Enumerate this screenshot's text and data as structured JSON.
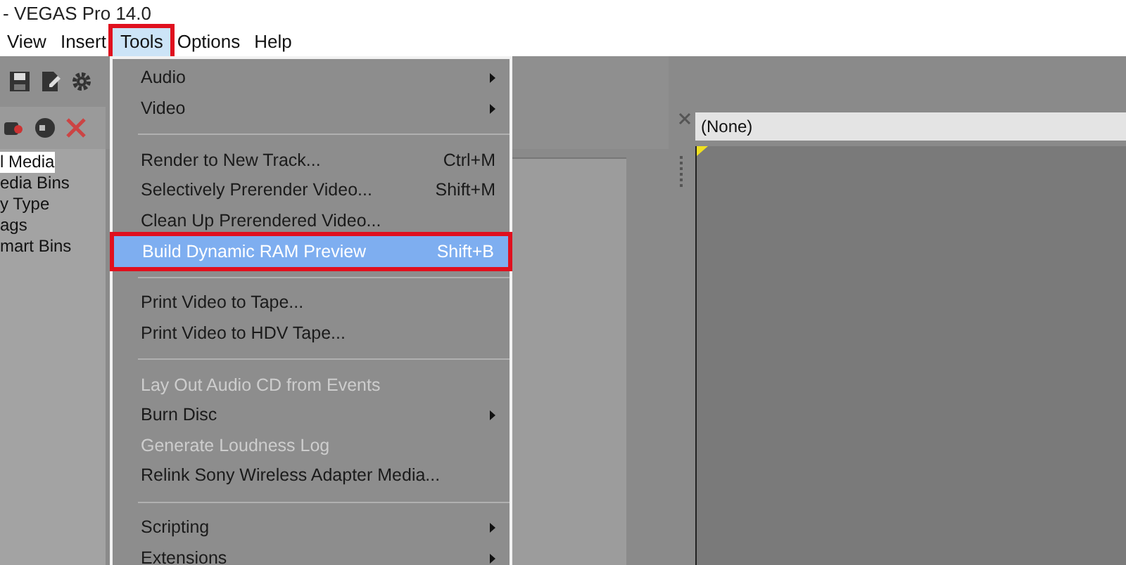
{
  "window": {
    "title": "- VEGAS Pro 14.0"
  },
  "menu_bar": [
    {
      "label": "View",
      "selected": false,
      "annotated": false
    },
    {
      "label": "Insert",
      "selected": false,
      "annotated": false
    },
    {
      "label": "Tools",
      "selected": true,
      "annotated": true
    },
    {
      "label": "Options",
      "selected": false,
      "annotated": false
    },
    {
      "label": "Help",
      "selected": false,
      "annotated": false
    }
  ],
  "media_tree": [
    {
      "label": "l Media",
      "selected": true
    },
    {
      "label": "edia Bins",
      "selected": false
    },
    {
      "label": "y Type",
      "selected": false
    },
    {
      "label": "ags",
      "selected": false
    },
    {
      "label": "mart Bins",
      "selected": false
    }
  ],
  "tools_menu": [
    {
      "kind": "item",
      "label": "Audio",
      "submenu": true,
      "disabled": false,
      "selected": false,
      "annotated": false
    },
    {
      "kind": "item",
      "label": "Video",
      "submenu": true,
      "disabled": false,
      "selected": false,
      "annotated": false
    },
    {
      "kind": "separator"
    },
    {
      "kind": "item",
      "label": "Render to New Track...",
      "shortcut": "Ctrl+M",
      "submenu": false,
      "disabled": false,
      "selected": false,
      "annotated": false
    },
    {
      "kind": "item",
      "label": "Selectively Prerender Video...",
      "shortcut": "Shift+M",
      "submenu": false,
      "disabled": false,
      "selected": false,
      "annotated": false
    },
    {
      "kind": "item",
      "label": "Clean Up Prerendered Video...",
      "submenu": false,
      "disabled": false,
      "selected": false,
      "annotated": false
    },
    {
      "kind": "item",
      "label": "Build Dynamic RAM Preview",
      "shortcut": "Shift+B",
      "submenu": false,
      "disabled": false,
      "selected": true,
      "annotated": true
    },
    {
      "kind": "separator"
    },
    {
      "kind": "item",
      "label": "Print Video to Tape...",
      "submenu": false,
      "disabled": false,
      "selected": false,
      "annotated": false
    },
    {
      "kind": "item",
      "label": "Print Video to HDV Tape...",
      "submenu": false,
      "disabled": false,
      "selected": false,
      "annotated": false
    },
    {
      "kind": "separator"
    },
    {
      "kind": "item",
      "label": "Lay Out Audio CD from Events",
      "submenu": false,
      "disabled": true,
      "selected": false,
      "annotated": false
    },
    {
      "kind": "item",
      "label": "Burn Disc",
      "submenu": true,
      "disabled": false,
      "selected": false,
      "annotated": false
    },
    {
      "kind": "item",
      "label": "Generate Loudness Log",
      "submenu": false,
      "disabled": true,
      "selected": false,
      "annotated": false
    },
    {
      "kind": "item",
      "label": "Relink Sony Wireless Adapter Media...",
      "submenu": false,
      "disabled": false,
      "selected": false,
      "annotated": false
    },
    {
      "kind": "separator"
    },
    {
      "kind": "item",
      "label": "Scripting",
      "submenu": true,
      "disabled": false,
      "selected": false,
      "annotated": false
    },
    {
      "kind": "item",
      "label": "Extensions",
      "submenu": true,
      "disabled": false,
      "selected": false,
      "annotated": false
    }
  ],
  "preview": {
    "device": "(None)"
  }
}
